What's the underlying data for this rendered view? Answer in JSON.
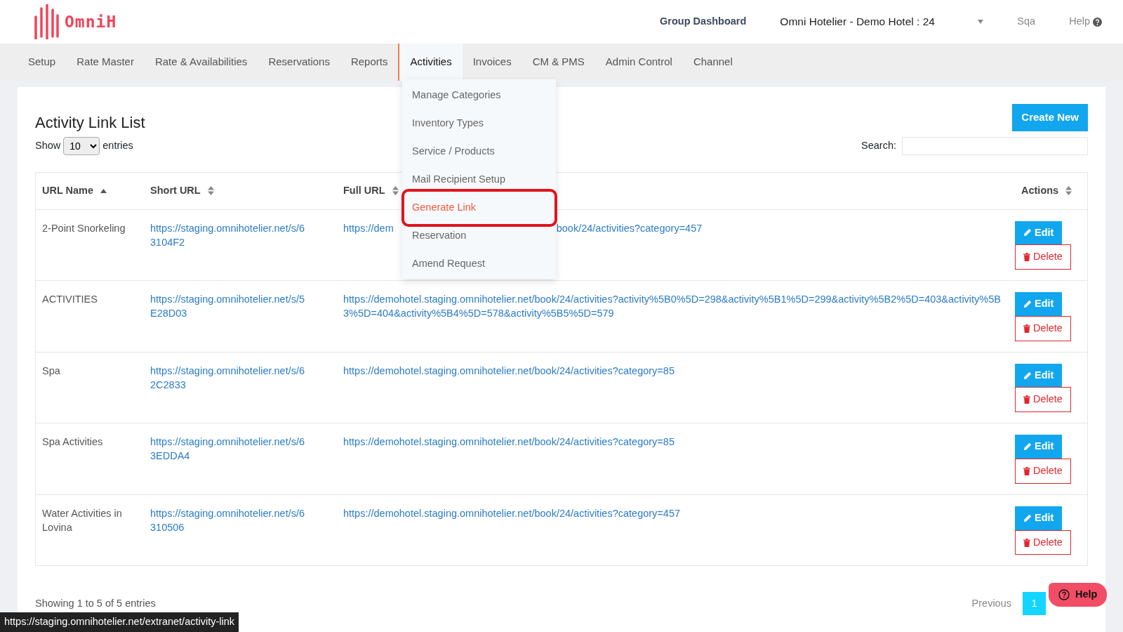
{
  "header": {
    "logo_text": "OmniH",
    "links": [
      "Group Dashboard"
    ],
    "hotel_select": "Omni Hotelier - Demo Hotel : 24",
    "user": "Sqa",
    "help": "Help"
  },
  "nav": [
    {
      "label": "Setup",
      "selected": false
    },
    {
      "label": "Rate Master",
      "selected": false
    },
    {
      "label": "Rate & Availabilities",
      "selected": false
    },
    {
      "label": "Reservations",
      "selected": false
    },
    {
      "label": "Reports",
      "selected": false
    },
    {
      "label": "Activities",
      "selected": true
    },
    {
      "label": "Invoices",
      "selected": false
    },
    {
      "label": "CM & PMS",
      "selected": false
    },
    {
      "label": "Admin Control",
      "selected": false
    },
    {
      "label": "Channel",
      "selected": false
    }
  ],
  "dropdown": [
    {
      "label": "Manage Categories",
      "selected": false
    },
    {
      "label": "Inventory Types",
      "selected": false
    },
    {
      "label": "Service / Products",
      "selected": false
    },
    {
      "label": "Mail Recipient Setup",
      "selected": false
    },
    {
      "label": "Generate Link",
      "selected": true
    },
    {
      "label": "Reservation",
      "selected": false
    },
    {
      "label": "Amend Request",
      "selected": false
    }
  ],
  "page": {
    "title": "Activity Link List",
    "create_button": "Create New",
    "show_label": "Show",
    "page_length": "10",
    "entries_label": "entries",
    "search_label": "Search:"
  },
  "table": {
    "columns": [
      {
        "label": "URL Name",
        "sorted": true
      },
      {
        "label": "Short URL",
        "sorted": false
      },
      {
        "label": "Full URL",
        "sorted": false
      },
      {
        "label": "Actions",
        "sorted": false
      }
    ],
    "rows": [
      {
        "name": "2-Point Snorkeling",
        "short_url": "https://staging.omnihotelier.net/s/63104F2",
        "full_url_parts": [
          "https://dem",
          "book/24/activities?category=457"
        ],
        "edit_label": "Edit",
        "delete_label": "Delete"
      },
      {
        "name": "ACTIVITIES",
        "short_url": "https://staging.omnihotelier.net/s/5E28D03",
        "full_url_parts": [
          "https://demohotel.staging.omnihotelier.net/book/24/activities?activity%5B0%5D=298&activity%5B1%5D=299&activity%5B2%5D=403&activity%5B3%5D=404&activity%5B4%5D=578&activity%5B5%5D=579"
        ],
        "edit_label": "Edit",
        "delete_label": "Delete"
      },
      {
        "name": "Spa",
        "short_url": "https://staging.omnihotelier.net/s/62C2833",
        "full_url_parts": [
          "https://demohotel.staging.omnihotelier.net/book/24/activities?category=85"
        ],
        "edit_label": "Edit",
        "delete_label": "Delete"
      },
      {
        "name": "Spa Activities",
        "short_url": "https://staging.omnihotelier.net/s/63EDDA4",
        "full_url_parts": [
          "https://demohotel.staging.omnihotelier.net/book/24/activities?category=85"
        ],
        "edit_label": "Edit",
        "delete_label": "Delete"
      },
      {
        "name": "Water Activities in Lovina",
        "short_url": "https://staging.omnihotelier.net/s/6310506",
        "full_url_parts": [
          "https://demohotel.staging.omnihotelier.net/book/24/activities?category=457"
        ],
        "edit_label": "Edit",
        "delete_label": "Delete"
      }
    ]
  },
  "footer": {
    "info": "Showing 1 to 5 of 5 entries",
    "previous": "Previous",
    "pages": [
      {
        "label": "1",
        "selected": true
      }
    ]
  },
  "help_button": "Help",
  "status_url": "https://staging.omnihotelier.net/extranet/activity-link"
}
